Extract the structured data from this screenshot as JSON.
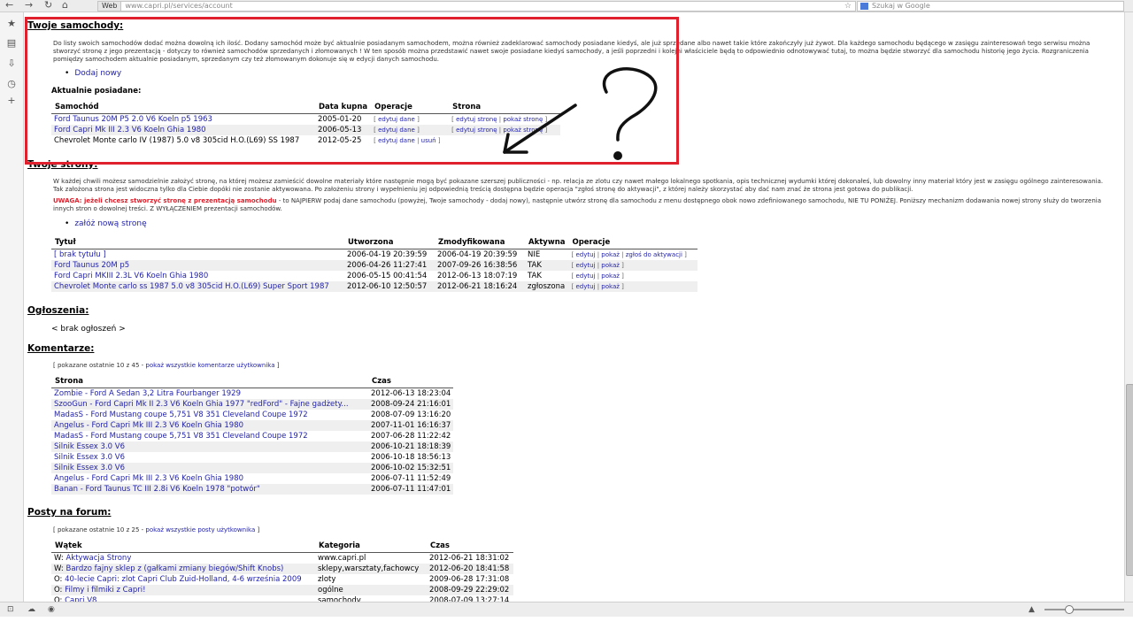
{
  "browser": {
    "back": "←",
    "forward": "→",
    "reload": "↻",
    "home": "⌂",
    "site_tag": "Web",
    "url": "www.capri.pl/services/account",
    "star": "☆",
    "search_placeholder": "Szukaj w Google",
    "sidebar_icons": [
      "star-icon",
      "bookmarks-icon",
      "downloads-icon",
      "history-icon",
      "add-icon"
    ]
  },
  "cars": {
    "heading": "Twoje samochody:",
    "intro": "Do listy swoich samochodów dodać można dowolną ich ilość. Dodany samochód może być aktualnie posiadanym samochodem, można również zadeklarować samochody posiadane kiedyś, ale już sprzedane albo nawet takie które zakończyły już żywot. Dla każdego samochodu będącego w zasięgu zainteresowań tego serwisu można stworzyć stronę z jego prezentacją - dotyczy to również samochodów sprzedanych i złomowanych ! W ten sposób można przedstawić nawet swoje posiadane kiedyś samochody, a jeśli poprzedni i kolejni właściciele będą to odpowiednio odnotowywać tutaj, to można będzie stworzyć dla samochodu historię jego życia. Rozgraniczenia pomiędzy samochodem aktualnie posiadanym, sprzedanym czy też złomowanym dokonuje się w edycji danych samochodu.",
    "add_new": "Dodaj nowy",
    "current_label": "Aktualnie posiadane:",
    "columns": [
      "Samochód",
      "Data kupna",
      "Operacje",
      "Strona"
    ],
    "rows": [
      {
        "name": "Ford Taunus 20M P5 2.0 V6 Koeln p5 1963",
        "date": "2005-01-20",
        "link": true
      },
      {
        "name": "Ford Capri Mk III 2.3 V6 Koeln Ghia 1980",
        "date": "2006-05-13",
        "link": true
      },
      {
        "name": "Chevrolet Monte carlo IV (1987) 5.0 v8 305cid H.O.(L69) SS 1987",
        "date": "2012-05-25",
        "link": false
      }
    ],
    "op_edit_data": "edytuj dane",
    "op_delete": "usuń",
    "page_edit": "edytuj stronę",
    "page_show": "pokaż stronę"
  },
  "pages": {
    "heading": "Twoje strony:",
    "intro": "W każdej chwili możesz samodzielnie założyć stronę, na której możesz zamieścić dowolne materiały które następnie mogą być pokazane szerszej publiczności - np. relacja ze zlotu czy nawet małego lokalnego spotkania, opis technicznej wydumki której dokonałeś, lub dowolny inny materiał który jest w zasięgu ogólnego zainteresowania. Tak założona strona jest widoczna tylko dla Ciebie dopóki nie zostanie aktywowana. Po założeniu strony i wypełnieniu jej odpowiednią treścią dostępna będzie operacja \"zgłoś stronę do aktywacji\", z której należy skorzystać aby dać nam znać że strona jest gotowa do publikacji.",
    "warning_label": "UWAGA: jeżeli chcesz stworzyć stronę z prezentacją samochodu",
    "warning_text": " - to NAJPIERW podaj dane samochodu (powyżej, Twoje samochody - dodaj nowy), następnie utwórz stronę dla samochodu z menu dostępnego obok nowo zdefiniowanego samochodu, NIE TU PONIŻEJ. Poniższy mechanizm dodawania nowej strony służy do tworzenia innych stron o dowolnej treści. Z WYŁĄCZENIEM prezentacji samochodów.",
    "add_new": "załóż nową stronę",
    "columns": [
      "Tytuł",
      "Utworzona",
      "Zmodyfikowana",
      "Aktywna",
      "Operacje"
    ],
    "rows": [
      {
        "title": "[ brak tytułu ]",
        "created": "2006-04-19 20:39:59",
        "modified": "2006-04-19 20:39:59",
        "active": "NIE",
        "extra": "zgłoś do aktywacji"
      },
      {
        "title": "Ford Taunus 20M p5",
        "created": "2006-04-26 11:27:41",
        "modified": "2007-09-26 16:38:56",
        "active": "TAK",
        "extra": ""
      },
      {
        "title": "Ford Capri MKIII 2.3L V6 Koeln Ghia 1980",
        "created": "2006-05-15 00:41:54",
        "modified": "2012-06-13 18:07:19",
        "active": "TAK",
        "extra": ""
      },
      {
        "title": "Chevrolet Monte carlo ss 1987 5.0 v8 305cid H.O.(L69) Super Sport 1987",
        "created": "2012-06-10 12:50:57",
        "modified": "2012-06-21 18:16:24",
        "active": "zgłoszona",
        "extra": ""
      }
    ],
    "op_edit": "edytuj",
    "op_show": "pokaż"
  },
  "ads": {
    "heading": "Ogłoszenia:",
    "empty": "< brak ogłoszeń >"
  },
  "comments": {
    "heading": "Komentarze:",
    "note_prefix": "[ pokazane ostatnie 10 z 45 - ",
    "note_link": "pokaż wszystkie komentarze użytkownika",
    "note_suffix": " ]",
    "columns": [
      "Strona",
      "Czas"
    ],
    "rows": [
      {
        "page": "Zombie - Ford A Sedan 3,2 Litra Fourbanger 1929",
        "time": "2012-06-13 18:23:04"
      },
      {
        "page": "SzooGun - Ford Capri Mk II 2.3 V6 Koeln Ghia 1977 \"redFord\" - Fajne gadżety...",
        "time": "2008-09-24 21:16:01"
      },
      {
        "page": "MadasS - Ford Mustang coupe 5,751 V8 351 Cleveland Coupe 1972",
        "time": "2008-07-09 13:16:20"
      },
      {
        "page": "Angelus - Ford Capri Mk III 2.3 V6 Koeln Ghia 1980",
        "time": "2007-11-01 16:16:37"
      },
      {
        "page": "MadasS - Ford Mustang coupe 5,751 V8 351 Cleveland Coupe 1972",
        "time": "2007-06-28 11:22:42"
      },
      {
        "page": "Silnik Essex 3.0 V6",
        "time": "2006-10-21 18:18:39"
      },
      {
        "page": "Silnik Essex 3.0 V6",
        "time": "2006-10-18 18:56:13"
      },
      {
        "page": "Silnik Essex 3.0 V6",
        "time": "2006-10-02 15:32:51"
      },
      {
        "page": "Angelus - Ford Capri Mk III 2.3 V6 Koeln Ghia 1980",
        "time": "2006-07-11 11:52:49"
      },
      {
        "page": "Banan - Ford Taunus TC III 2.8i V6 Koeln 1978 \"potwór\"",
        "time": "2006-07-11 11:47:01"
      }
    ]
  },
  "forum": {
    "heading": "Posty na forum:",
    "note_prefix": "[ pokazane ostatnie 10 z 25 - ",
    "note_link": "pokaż wszystkie posty użytkownika",
    "note_suffix": " ]",
    "columns": [
      "Wątek",
      "Kategoria",
      "Czas"
    ],
    "rows": [
      {
        "prefix": "W:",
        "thread": "Aktywacja Strony",
        "category": "www.capri.pl",
        "time": "2012-06-21 18:31:02"
      },
      {
        "prefix": "W:",
        "thread": "Bardzo fajny sklep z (gałkami zmiany biegów/Shift Knobs)",
        "category": "sklepy,warsztaty,fachowcy",
        "time": "2012-06-20 18:41:58"
      },
      {
        "prefix": "O:",
        "thread": "40-lecie Capri: zlot Capri Club Zuid-Holland, 4-6 września 2009",
        "category": "zloty",
        "time": "2009-06-28 17:31:08"
      },
      {
        "prefix": "O:",
        "thread": "Filmy i filmiki z Capri!",
        "category": "ogólne",
        "time": "2008-09-29 22:29:02"
      },
      {
        "prefix": "O:",
        "thread": "Capri V8",
        "category": "samochody",
        "time": "2008-07-09 13:27:14"
      }
    ]
  },
  "annotation": {
    "symbol": "?"
  }
}
